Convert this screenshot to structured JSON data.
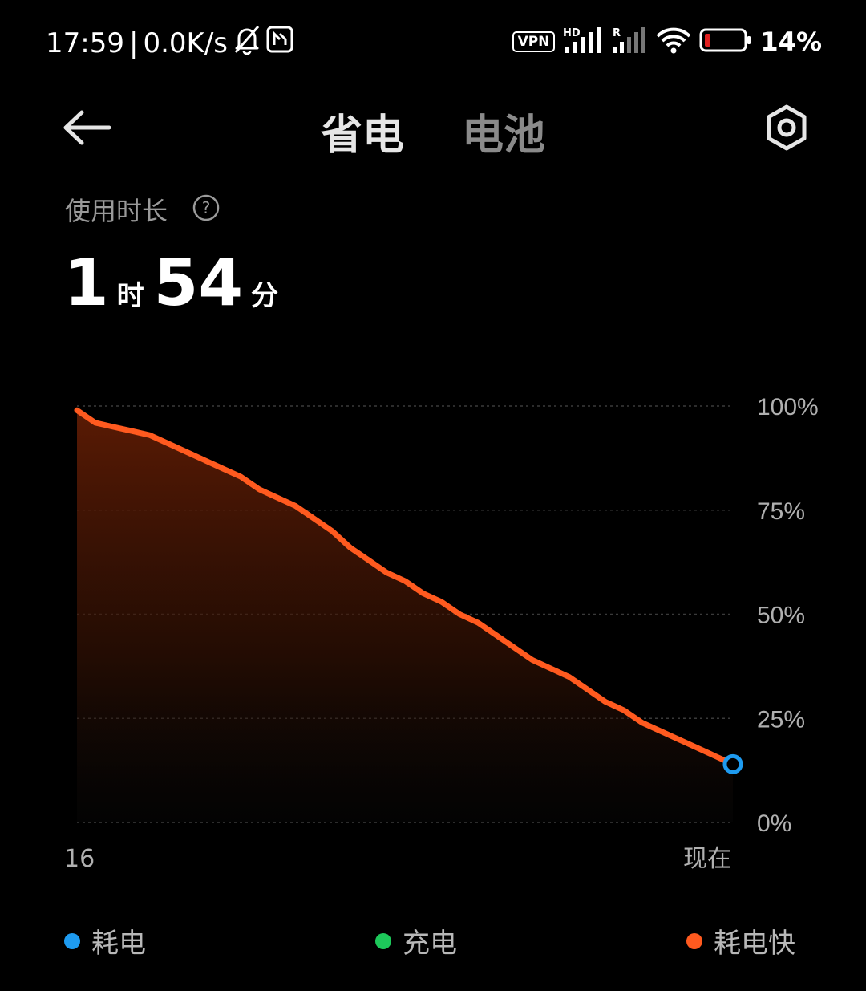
{
  "status_bar": {
    "time": "17:59",
    "separator": "|",
    "net_speed": "0.0K/s",
    "vpn_label": "VPN",
    "hd_label": "HD",
    "r_label": "R",
    "battery_percent": "14%"
  },
  "header": {
    "tab_power_saving": "省电",
    "tab_battery": "电池"
  },
  "usage": {
    "label": "使用时长",
    "help_symbol": "?",
    "hours_value": "1",
    "hours_unit": "时",
    "minutes_value": "54",
    "minutes_unit": "分"
  },
  "chart_data": {
    "type": "area",
    "x_start_label": "16",
    "x_end_label": "现在",
    "y_ticks": [
      "100%",
      "75%",
      "50%",
      "25%",
      "0%"
    ],
    "ylim": [
      0,
      100
    ],
    "grid": true,
    "series": [
      {
        "name": "耗电快",
        "color": "#ff5a1f",
        "values": [
          99,
          96,
          95,
          94,
          93,
          91,
          89,
          87,
          85,
          83,
          80,
          78,
          76,
          73,
          70,
          66,
          63,
          60,
          58,
          55,
          53,
          50,
          48,
          45,
          42,
          39,
          37,
          35,
          32,
          29,
          27,
          24,
          22,
          20,
          18,
          16,
          14
        ]
      }
    ],
    "current_point": {
      "value": 14,
      "color": "#1e9bf0"
    }
  },
  "legend": {
    "items": [
      {
        "label": "耗电",
        "color": "#1e9bf0"
      },
      {
        "label": "充电",
        "color": "#1dc85a"
      },
      {
        "label": "耗电快",
        "color": "#ff5a1f"
      }
    ]
  }
}
